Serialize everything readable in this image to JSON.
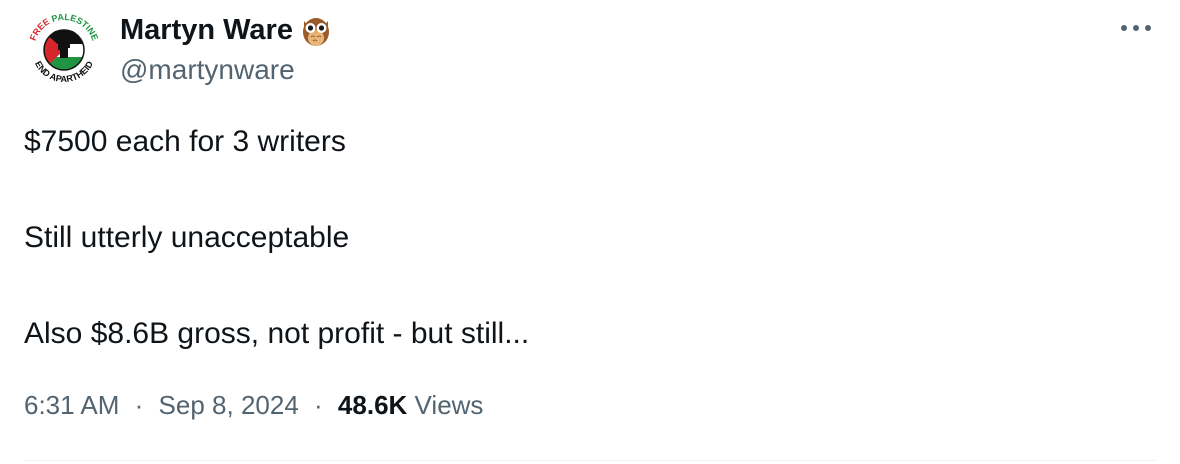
{
  "author": {
    "display_name": "Martyn Ware",
    "handle": "@martynware",
    "badge_icon": "owl-icon",
    "avatar": {
      "icon": "free-palestine-end-apartheid-logo",
      "text_top": "FREE PALESTINE",
      "text_bottom": "END APARTHEID",
      "colors": {
        "red": "#d7262b",
        "green": "#1f9443",
        "black": "#111111",
        "white": "#ffffff"
      }
    }
  },
  "more_icon": "more-horizontal-icon",
  "tweet": {
    "lines": [
      "$7500 each for 3 writers",
      "Still utterly unacceptable",
      "Also $8.6B gross, not profit - but still..."
    ]
  },
  "meta": {
    "time": "6:31 AM",
    "separator": "·",
    "date": "Sep 8, 2024",
    "views_count": "48.6K",
    "views_label": "Views"
  },
  "colors": {
    "primary_text": "#0f1419",
    "secondary_text": "#536471",
    "divider": "#eff3f4"
  }
}
